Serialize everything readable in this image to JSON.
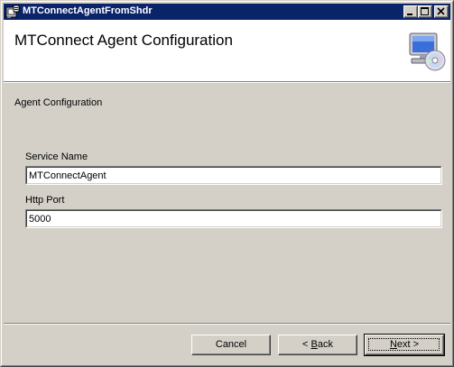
{
  "window": {
    "title": "MTConnectAgentFromShdr"
  },
  "icons": {
    "app": "installer-app-icon",
    "minimize": "minimize-icon",
    "maximize": "maximize-icon",
    "close": "close-icon",
    "header": "computer-with-disc-icon"
  },
  "header": {
    "title": "MTConnect Agent Configuration"
  },
  "section": {
    "label": "Agent Configuration"
  },
  "fields": {
    "service_name": {
      "label": "Service Name",
      "value": "MTConnectAgent"
    },
    "http_port": {
      "label": "Http Port",
      "value": "5000"
    }
  },
  "buttons": {
    "cancel": "Cancel",
    "back_prefix": "< ",
    "back_mnemonic": "B",
    "back_rest": "ack",
    "next_mnemonic": "N",
    "next_rest": "ext >"
  },
  "colors": {
    "titlebar": "#0a246a",
    "face": "#d4d0c8",
    "header_bg": "#ffffff"
  }
}
